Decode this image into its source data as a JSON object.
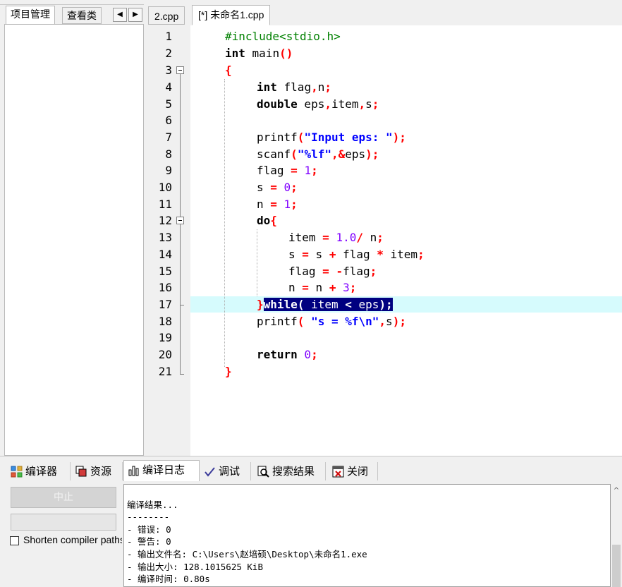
{
  "left_tabs": {
    "project": "项目管理",
    "classes": "查看类",
    "prev_arrow": "◀",
    "next_arrow": "▶"
  },
  "editor_tabs": [
    {
      "label": "2.cpp",
      "active": false
    },
    {
      "label": "[*] 未命名1.cpp",
      "active": true
    }
  ],
  "line_numbers": [
    "1",
    "2",
    "3",
    "4",
    "5",
    "6",
    "7",
    "8",
    "9",
    "10",
    "11",
    "12",
    "13",
    "14",
    "15",
    "16",
    "17",
    "18",
    "19",
    "20",
    "21"
  ],
  "code": {
    "l1_pp": "#include<stdio.h>",
    "l2_kw": "int",
    "l2_rest": " main",
    "l2_p": "()",
    "l3_b": "{",
    "l4_kw": "int",
    "l4_a": " flag",
    "l4_o1": ",",
    "l4_b": "n",
    "l4_o2": ";",
    "l5_kw": "double",
    "l5_a": " eps",
    "l5_o1": ",",
    "l5_b": "item",
    "l5_o2": ",",
    "l5_c": "s",
    "l5_o3": ";",
    "l7_a": "printf",
    "l7_o1": "(",
    "l7_s": "\"Input eps: \"",
    "l7_o2": ");",
    "l8_a": "scanf",
    "l8_o1": "(",
    "l8_s": "\"%lf\"",
    "l8_o2": ",&",
    "l8_b": "eps",
    "l8_o3": ");",
    "l9_a": "flag ",
    "l9_o1": "=",
    "l9_n": " 1",
    "l9_o2": ";",
    "l10_a": "s ",
    "l10_o1": "=",
    "l10_n": " 0",
    "l10_o2": ";",
    "l11_a": "n ",
    "l11_o1": "=",
    "l11_n": " 1",
    "l11_o2": ";",
    "l12_kw": "do",
    "l12_o": "{",
    "l13_a": "item ",
    "l13_o1": "=",
    "l13_n": " 1.0",
    "l13_o2": "/",
    "l13_b": " n",
    "l13_o3": ";",
    "l14_a": "s ",
    "l14_o1": "=",
    "l14_b": " s ",
    "l14_o2": "+",
    "l14_c": " flag ",
    "l14_o3": "*",
    "l14_d": " item",
    "l14_o4": ";",
    "l15_a": "flag ",
    "l15_o1": "=",
    "l15_o2": " -",
    "l15_b": "flag",
    "l15_o3": ";",
    "l16_a": "n ",
    "l16_o1": "=",
    "l16_b": " n ",
    "l16_o2": "+",
    "l16_n": " 3",
    "l16_o3": ";",
    "l17_o1": "}",
    "l17_kw": "while",
    "l17_o2": "(",
    "l17_a": " item ",
    "l17_o3": "<",
    "l17_b": " eps",
    "l17_o4": ");",
    "l18_a": "printf",
    "l18_o1": "(",
    "l18_s": " \"s = %f\\n\"",
    "l18_o2": ",",
    "l18_b": "s",
    "l18_o3": ");",
    "l20_kw": "return",
    "l20_n": " 0",
    "l20_o": ";",
    "l21_b": "}"
  },
  "bottom_tabs": [
    {
      "label": "编译器",
      "icon": "grid-icon"
    },
    {
      "label": "资源",
      "icon": "resources-icon"
    },
    {
      "label": "编译日志",
      "icon": "bar-chart-icon",
      "active": true
    },
    {
      "label": "调试",
      "icon": "checkmark-icon"
    },
    {
      "label": "搜索结果",
      "icon": "magnifier-icon"
    },
    {
      "label": "关闭",
      "icon": "close-window-icon"
    }
  ],
  "compile_panel": {
    "stop_button": "中止",
    "shorten_label": "Shorten compiler paths"
  },
  "log_lines": [
    "编译结果...",
    "--------",
    "- 错误: 0",
    "- 警告: 0",
    "- 输出文件名: C:\\Users\\赵培硕\\Desktop\\未命名1.exe",
    "- 输出大小: 128.1015625 KiB",
    "- 编译时间: 0.80s"
  ],
  "colors": {
    "keyword": "#000000",
    "preprocessor": "#008000",
    "string": "#0000ff",
    "number": "#8000ff",
    "operator": "#ff0000",
    "current_line": "#d6fbfd",
    "selection": "#000080"
  }
}
